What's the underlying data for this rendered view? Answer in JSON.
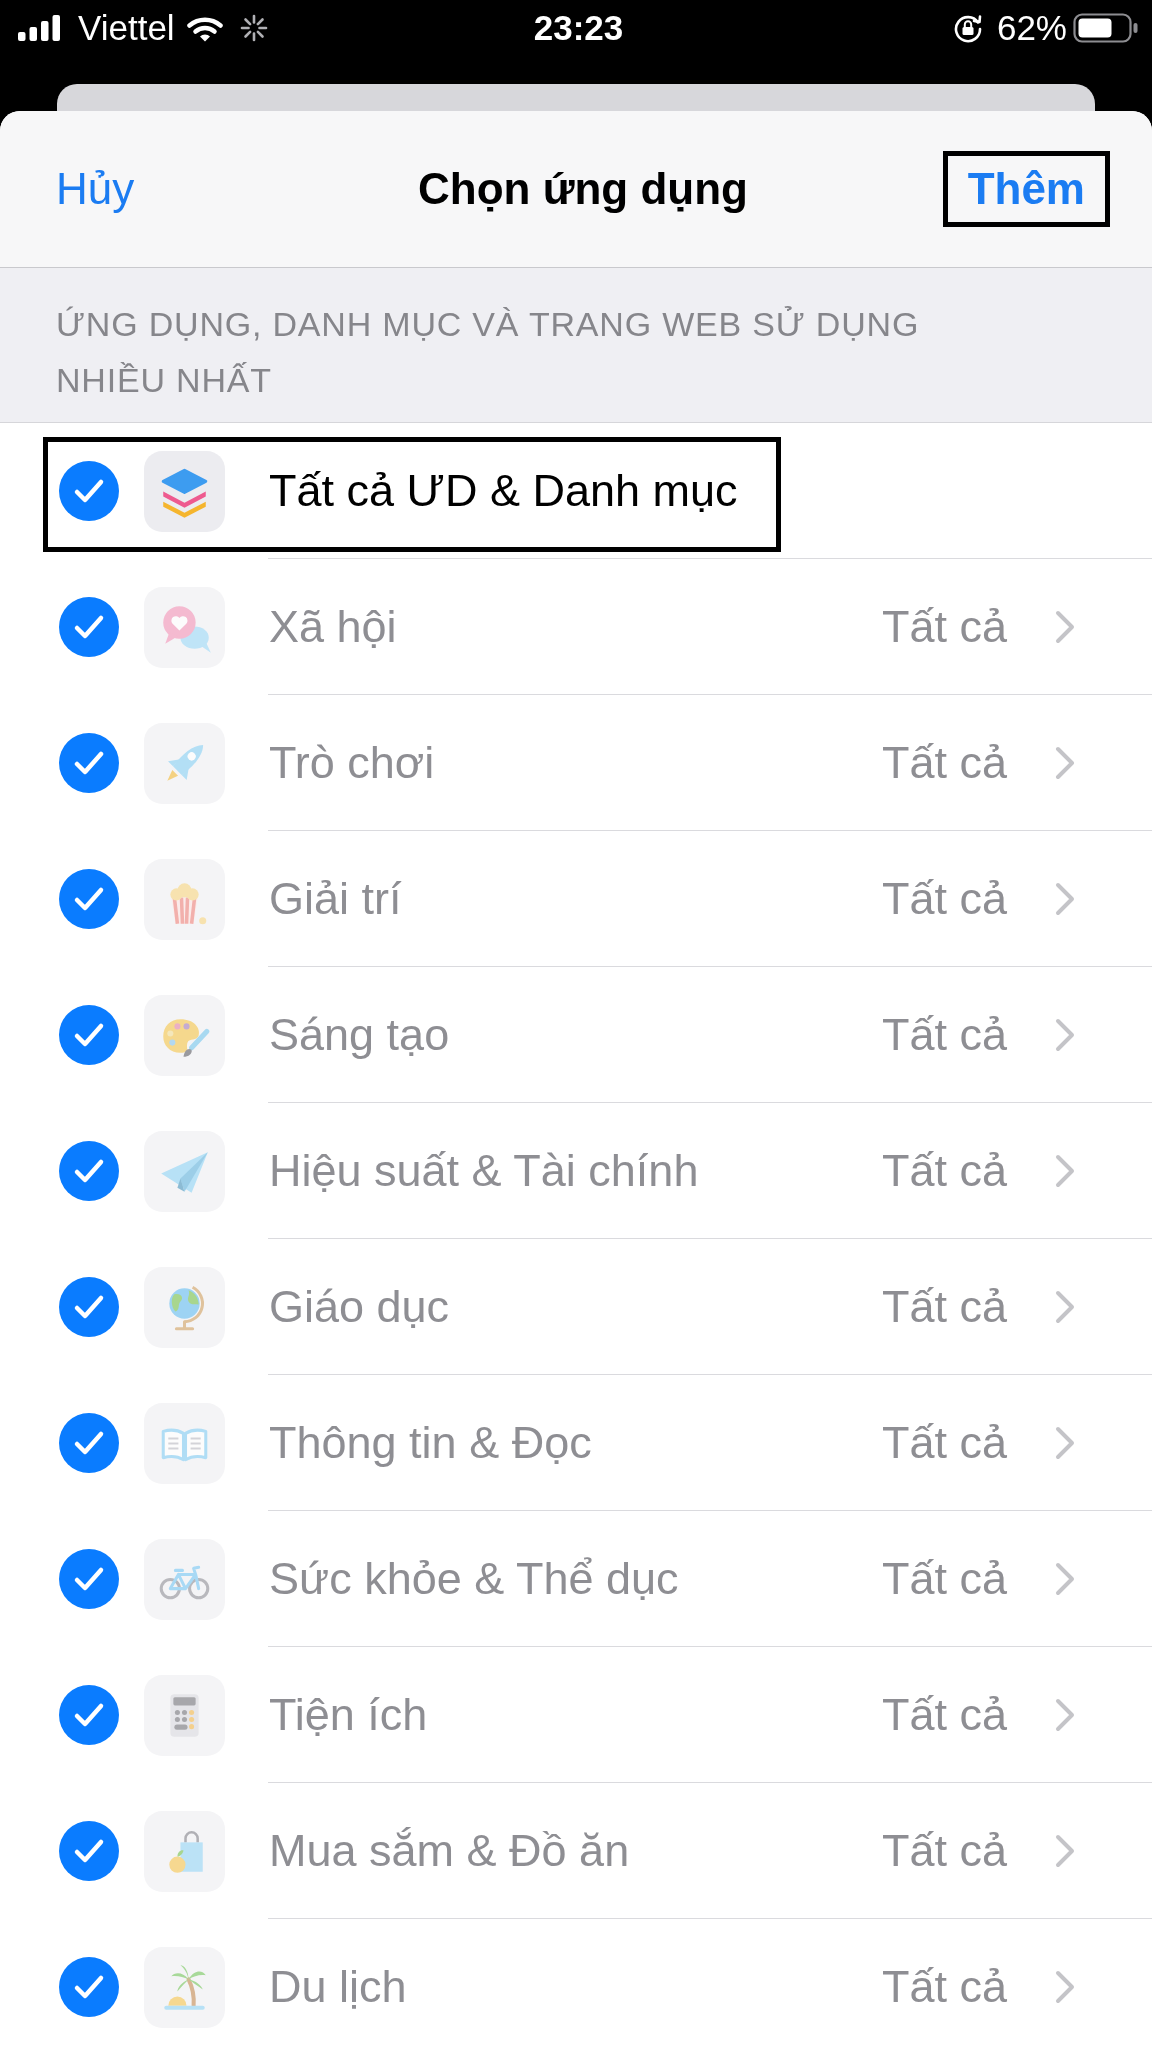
{
  "status_bar": {
    "carrier": "Viettel",
    "time": "23:23",
    "battery": "62%"
  },
  "header": {
    "cancel": "Hủy",
    "title": "Chọn ứng dụng",
    "add": {
      "label": "Thêm",
      "highlighted": true
    }
  },
  "section_title": "ỨNG DỤNG, DANH MỤC VÀ TRANG WEB SỬ DỤNG NHIỀU NHẤT",
  "items": [
    {
      "kind": "all",
      "label": "Tất cả ƯD & Danh mục",
      "checked": true,
      "disabled": false,
      "highlighted": true
    },
    {
      "kind": "category",
      "label": "Xã hội",
      "detail": "Tất cả",
      "checked": true,
      "disabled": true,
      "highlighted": false
    },
    {
      "kind": "category",
      "label": "Trò chơi",
      "detail": "Tất cả",
      "checked": true,
      "disabled": true,
      "highlighted": false
    },
    {
      "kind": "category",
      "label": "Giải trí",
      "detail": "Tất cả",
      "checked": true,
      "disabled": true,
      "highlighted": false
    },
    {
      "kind": "category",
      "label": "Sáng tạo",
      "detail": "Tất cả",
      "checked": true,
      "disabled": true,
      "highlighted": false
    },
    {
      "kind": "category",
      "label": "Hiệu suất & Tài chính",
      "detail": "Tất cả",
      "checked": true,
      "disabled": true,
      "highlighted": false
    },
    {
      "kind": "category",
      "label": "Giáo dục",
      "detail": "Tất cả",
      "checked": true,
      "disabled": true,
      "highlighted": false
    },
    {
      "kind": "category",
      "label": "Thông tin & Đọc",
      "detail": "Tất cả",
      "checked": true,
      "disabled": true,
      "highlighted": false
    },
    {
      "kind": "category",
      "label": "Sức khỏe & Thể dục",
      "detail": "Tất cả",
      "checked": true,
      "disabled": true,
      "highlighted": false
    },
    {
      "kind": "category",
      "label": "Tiện ích",
      "detail": "Tất cả",
      "checked": true,
      "disabled": true,
      "highlighted": false
    },
    {
      "kind": "category",
      "label": "Mua sắm & Đồ ăn",
      "detail": "Tất cả",
      "checked": true,
      "disabled": true,
      "highlighted": false
    },
    {
      "kind": "category",
      "label": "Du lịch",
      "detail": "Tất cả",
      "checked": true,
      "disabled": true,
      "highlighted": false
    }
  ]
}
